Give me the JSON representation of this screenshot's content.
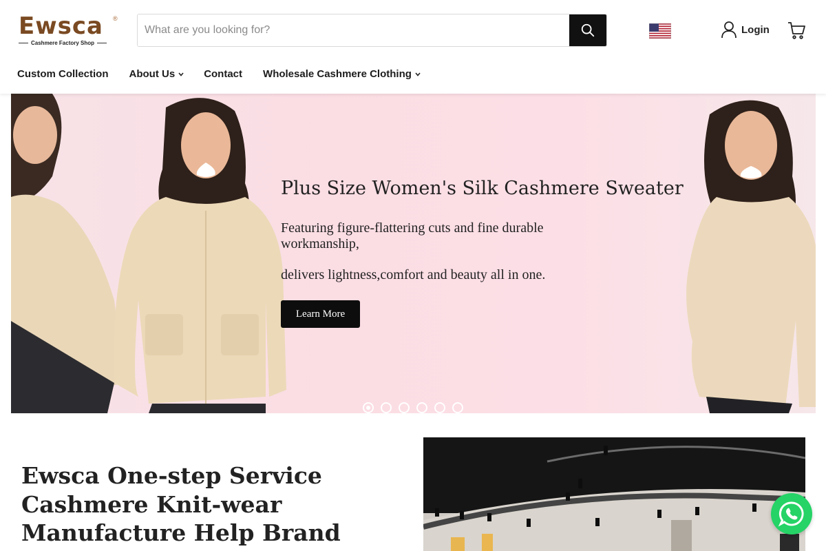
{
  "brand": {
    "name": "Ewsca",
    "registered_mark": "®",
    "tagline": "Cashmere Factory Shop",
    "color": "#7a4a22"
  },
  "search": {
    "placeholder": "What are you looking for?",
    "value": "",
    "icon": "search-icon"
  },
  "header": {
    "country_flag": "us-flag-icon",
    "login_label": "Login",
    "login_icon": "user-icon",
    "cart_icon": "cart-icon"
  },
  "nav": {
    "items": [
      {
        "label": "Custom Collection",
        "has_dropdown": false
      },
      {
        "label": "About Us",
        "has_dropdown": true
      },
      {
        "label": "Contact",
        "has_dropdown": false
      },
      {
        "label": "Wholesale Cashmere Clothing",
        "has_dropdown": true
      }
    ]
  },
  "hero": {
    "title": "Plus Size Women's Silk Cashmere Sweater",
    "subtitle_line1": "Featuring figure-flattering cuts and fine durable workmanship,",
    "subtitle_line2": "delivers lightness,comfort and beauty all in one.",
    "button_label": "Learn More",
    "slide_count": 6,
    "active_slide": 1,
    "background_color": "#fbdde4"
  },
  "about": {
    "heading": "Ewsca One-step Service Cashmere Knit-wear Manufacture Help Brand Building Unique Style"
  },
  "floating": {
    "whatsapp_icon": "whatsapp-icon",
    "whatsapp_color": "#25d366"
  }
}
